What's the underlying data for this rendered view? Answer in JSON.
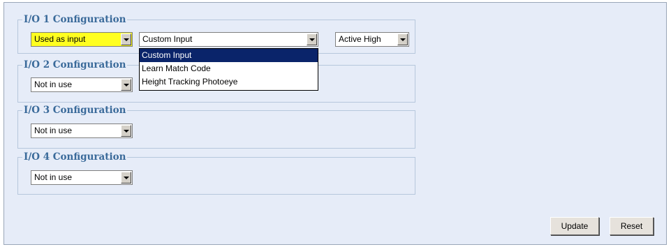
{
  "io1": {
    "legend": "I/O 1 Configuration",
    "mode_value": "Used as input",
    "function_value": "Custom Input",
    "polarity_value": "Active High",
    "dropdown_options": [
      "Custom Input",
      "Learn Match Code",
      "Height Tracking Photoeye"
    ],
    "highlight_color": "#ffff20"
  },
  "io2": {
    "legend": "I/O 2 Configuration",
    "mode_value": "Not in use"
  },
  "io3": {
    "legend": "I/O 3 Configuration",
    "mode_value": "Not in use"
  },
  "io4": {
    "legend": "I/O 4 Configuration",
    "mode_value": "Not in use"
  },
  "buttons": {
    "update_label": "Update",
    "reset_label": "Reset"
  },
  "colors": {
    "panel_bg": "#e6ecf8",
    "legend_text": "#3a6a9a",
    "selected_option_bg": "#0a246a"
  }
}
